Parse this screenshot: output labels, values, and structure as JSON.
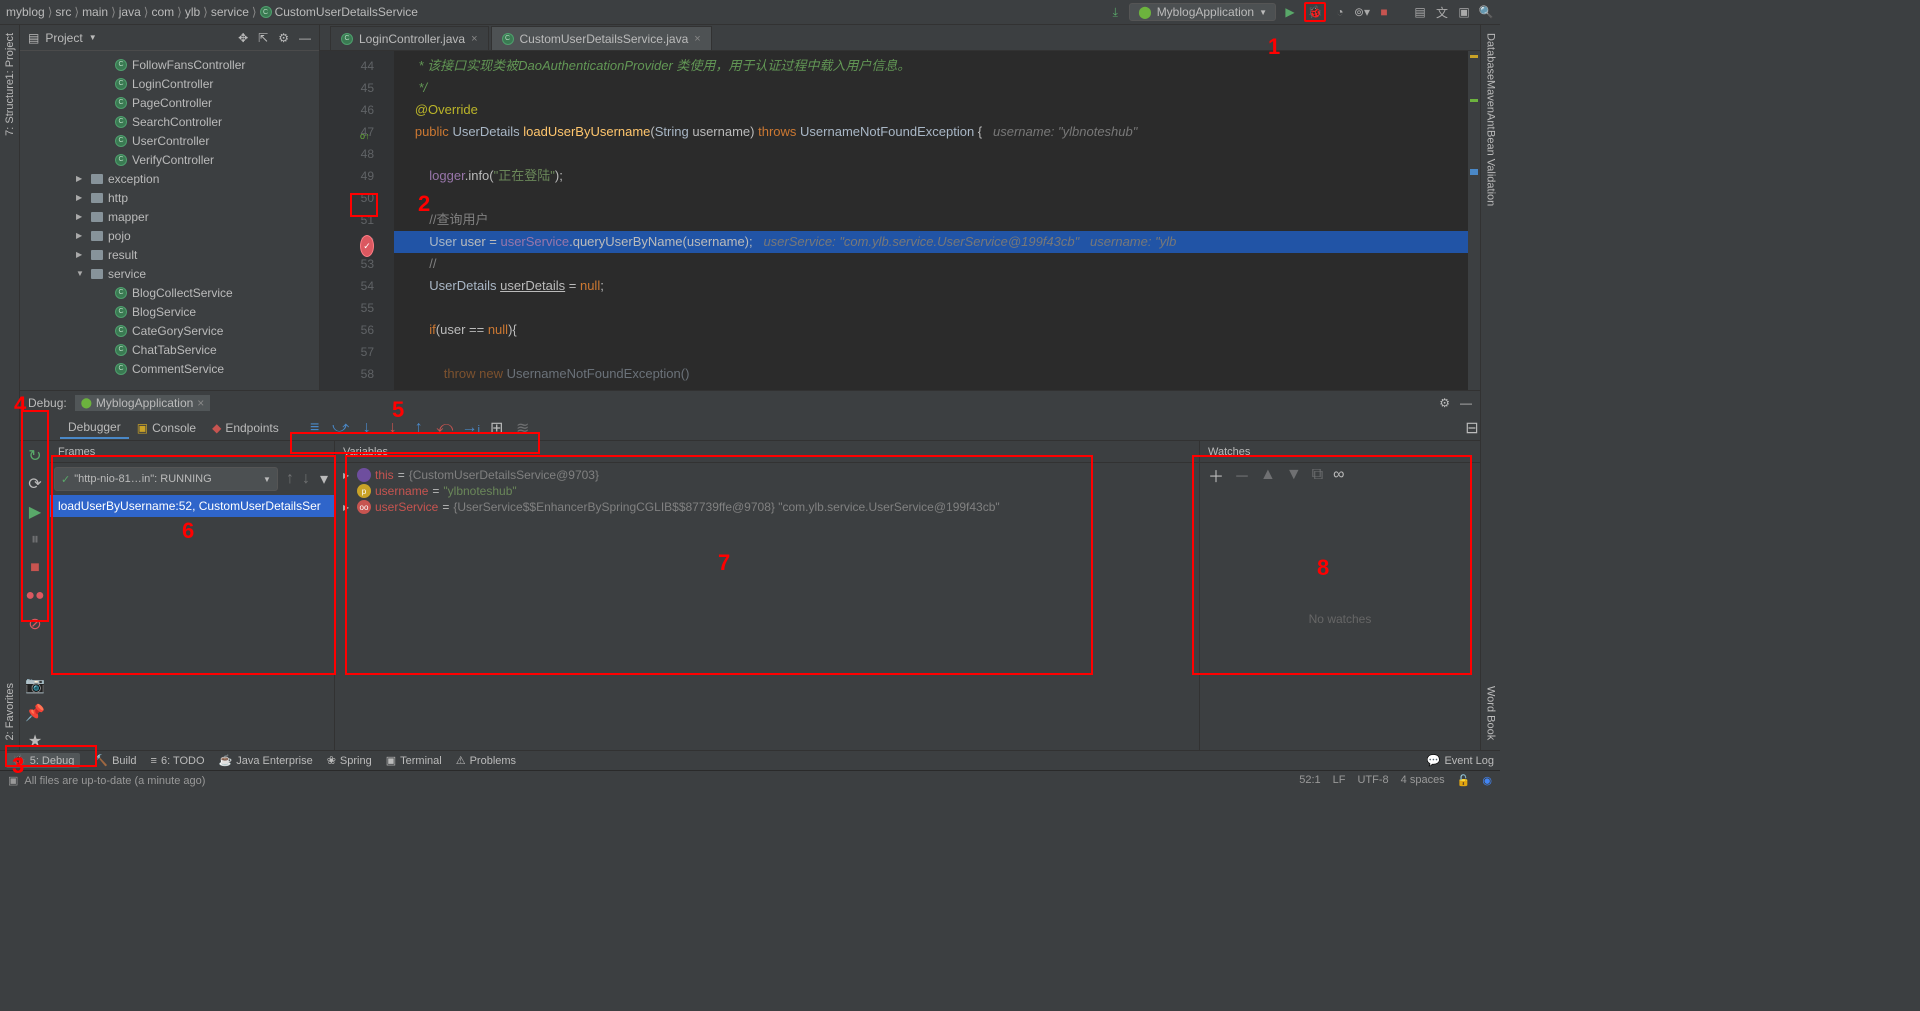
{
  "breadcrumb": [
    "myblog",
    "src",
    "main",
    "java",
    "com",
    "ylb",
    "service",
    "CustomUserDetailsService"
  ],
  "breadcrumb_icon_last": "class-icon",
  "run_config": {
    "label": "MyblogApplication"
  },
  "project_header": {
    "title": "Project"
  },
  "project_tree": [
    {
      "indent": 6,
      "type": "class",
      "label": "FollowFansController"
    },
    {
      "indent": 6,
      "type": "class",
      "label": "LoginController"
    },
    {
      "indent": 6,
      "type": "class",
      "label": "PageController"
    },
    {
      "indent": 6,
      "type": "class",
      "label": "SearchController"
    },
    {
      "indent": 6,
      "type": "class",
      "label": "UserController"
    },
    {
      "indent": 6,
      "type": "class",
      "label": "VerifyController"
    },
    {
      "indent": 4,
      "type": "folder",
      "arrow": "▶",
      "label": "exception"
    },
    {
      "indent": 4,
      "type": "folder",
      "arrow": "▶",
      "label": "http"
    },
    {
      "indent": 4,
      "type": "folder",
      "arrow": "▶",
      "label": "mapper"
    },
    {
      "indent": 4,
      "type": "folder",
      "arrow": "▶",
      "label": "pojo"
    },
    {
      "indent": 4,
      "type": "folder",
      "arrow": "▶",
      "label": "result"
    },
    {
      "indent": 4,
      "type": "folder",
      "arrow": "▼",
      "label": "service"
    },
    {
      "indent": 6,
      "type": "class",
      "label": "BlogCollectService"
    },
    {
      "indent": 6,
      "type": "class",
      "label": "BlogService"
    },
    {
      "indent": 6,
      "type": "class",
      "label": "CateGoryService"
    },
    {
      "indent": 6,
      "type": "class",
      "label": "ChatTabService"
    },
    {
      "indent": 6,
      "type": "class",
      "label": "CommentService"
    }
  ],
  "editor_tabs": [
    {
      "label": "LoginController.java",
      "active": false,
      "icon": "class-icon"
    },
    {
      "label": "CustomUserDetailsService.java",
      "active": true,
      "icon": "class-icon"
    }
  ],
  "code_lines": [
    {
      "n": 44,
      "html": "    <span class='cm-doc'>* 该接口实现类被DaoAuthenticationProvider 类使用，用于认证过程中载入用户信息。</span>"
    },
    {
      "n": 45,
      "html": "    <span class='cm-doc'>*/</span>"
    },
    {
      "n": 46,
      "html": "   <span class='cm-override'>@Override</span>"
    },
    {
      "n": 47,
      "html": "   <span class='cm-k'>public</span> <span class='cm-type'>UserDetails</span> <span class='cm-method'>loadUserByUsername</span>(<span class='cm-type'>String</span> username) <span class='cm-k'>throws</span> <span class='cm-type'>UsernameNotFoundException</span> {   <span class='cm-inlay'>username: \"ylbnoteshub\"</span>"
    },
    {
      "n": 48,
      "html": ""
    },
    {
      "n": 49,
      "html": "       <span class='cm-field'>logger</span>.info(<span class='cm-str'>\"正在登陆\"</span>);"
    },
    {
      "n": 50,
      "html": ""
    },
    {
      "n": 51,
      "html": "       <span class='cm-comment'>//查询用户</span>"
    },
    {
      "n": 52,
      "hl": true,
      "html": "       <span class='cm-type'>User</span> user = <span class='cm-field'>userService</span>.queryUserByName(username);   <span class='cm-inlay'>userService: \"com.ylb.service.UserService@199f43cb\"   username: \"ylb</span>"
    },
    {
      "n": 53,
      "html": "       <span class='cm-comment'>//</span>"
    },
    {
      "n": 54,
      "html": "       <span class='cm-type'>UserDetails</span> <u>userDetails</u> = <span class='cm-k'>null</span>;"
    },
    {
      "n": 55,
      "html": ""
    },
    {
      "n": 56,
      "html": "       <span class='cm-k'>if</span>(user == <span class='cm-k'>null</span>){"
    },
    {
      "n": 57,
      "html": ""
    },
    {
      "n": 58,
      "html": "           <span class='cm-k' style='opacity:.5'>throw new</span> <span class='cm-type' style='opacity:.5'>UsernameNotFoundException()</span>"
    }
  ],
  "breakpoint_line": 52,
  "debug_title": "Debug:",
  "debug_app_tab": "MyblogApplication",
  "debug_tabs": [
    {
      "label": "Debugger",
      "active": true
    },
    {
      "label": "Console",
      "active": false,
      "icon": "console-icon"
    },
    {
      "label": "Endpoints",
      "active": false,
      "icon": "endpoints-icon"
    }
  ],
  "frames": {
    "header": "Frames",
    "thread": "\"http-nio-81…in\": RUNNING",
    "stack": [
      "loadUserByUsername:52, CustomUserDetailsSer"
    ]
  },
  "variables": {
    "header": "Variables",
    "rows": [
      {
        "ico": "#6e4e9e",
        "icoText": "",
        "arrow": "▶",
        "name": "this",
        "eq": " = ",
        "val": "{CustomUserDetailsService@9703}",
        "valcls": "v-gray"
      },
      {
        "ico": "#c9a227",
        "icoText": "p",
        "arrow": "",
        "name": "username",
        "eq": " = ",
        "val": "\"ylbnoteshub\"",
        "valcls": "v-str"
      },
      {
        "ico": "#c75450",
        "icoText": "oo",
        "arrow": "▶",
        "name": "userService",
        "eq": " = ",
        "val": "{UserService$$EnhancerBySpringCGLIB$$87739ffe@9708} \"com.ylb.service.UserService@199f43cb\"",
        "valcls": "v-gray"
      }
    ]
  },
  "watches": {
    "header": "Watches",
    "empty": "No watches"
  },
  "bottom_tabs": [
    {
      "label": "5: Debug",
      "active": true,
      "icon": "bug-icon"
    },
    {
      "label": "Build",
      "active": false,
      "icon": "hammer-icon"
    },
    {
      "label": "6: TODO",
      "active": false,
      "icon": "todo-icon"
    },
    {
      "label": "Java Enterprise",
      "active": false,
      "icon": "jee-icon"
    },
    {
      "label": "Spring",
      "active": false,
      "icon": "spring-icon"
    },
    {
      "label": "Terminal",
      "active": false,
      "icon": "terminal-icon"
    },
    {
      "label": "Problems",
      "active": false,
      "icon": "warning-icon"
    }
  ],
  "event_log": "Event Log",
  "status_left": "All files are up-to-date (a minute ago)",
  "status_right": {
    "pos": "52:1",
    "le": "LF",
    "enc": "UTF-8",
    "indent": "4 spaces"
  },
  "left_vtabs": [
    {
      "label": "1: Project"
    },
    {
      "label": "7: Structure"
    }
  ],
  "left_vtabs2": [
    {
      "label": "2: Favorites"
    }
  ],
  "right_vtabs": [
    {
      "label": "Database"
    },
    {
      "label": "Maven"
    },
    {
      "label": "Ant"
    },
    {
      "label": "Bean Validation"
    }
  ],
  "right_vtabs2": [
    {
      "label": "Word Book"
    }
  ]
}
